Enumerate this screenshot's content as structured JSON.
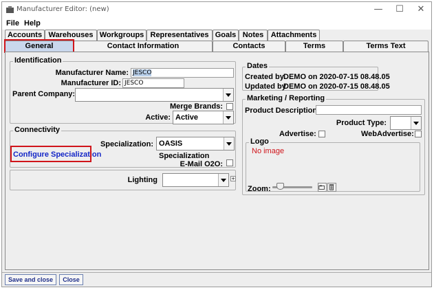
{
  "window": {
    "title": "Manufacturer Editor: (new)",
    "min": "—",
    "max": "☐",
    "close": "✕"
  },
  "menu": {
    "file": "File",
    "help": "Help"
  },
  "tabs_row1": [
    "Accounts",
    "Warehouses",
    "Workgroups",
    "Representatives",
    "Goals",
    "Notes",
    "Attachments"
  ],
  "tabs_row2": [
    "General",
    "Contact Information",
    "Contacts",
    "Terms",
    "Terms Text"
  ],
  "identification": {
    "title": "Identification",
    "name_label": "Manufacturer Name:",
    "name_value": "JESCO",
    "id_label": "Manufacturer ID:",
    "id_value": "JESCO",
    "parent_label": "Parent Company:",
    "parent_value": "",
    "merge_label": "Merge Brands:",
    "active_label": "Active:",
    "active_value": "Active"
  },
  "connectivity": {
    "title": "Connectivity",
    "spec_label": "Specialization:",
    "spec_value": "OASIS Specialization",
    "configure_link": "Configure Specialization",
    "email_label": "E-Mail O2O:"
  },
  "lighting": {
    "label": "Lighting",
    "value": ""
  },
  "dates": {
    "title": "Dates",
    "created_label": "Created by",
    "created_value": "DEMO on 2020-07-15 08.48.05",
    "updated_label": "Updated by",
    "updated_value": "DEMO on 2020-07-15 08.48.05"
  },
  "marketing": {
    "title": "Marketing / Reporting",
    "desc_label": "Product Description:",
    "desc_value": "",
    "type_label": "Product Type:",
    "type_value": "",
    "advertise_label": "Advertise:",
    "webadvertise_label": "WebAdvertise:"
  },
  "logo": {
    "title": "Logo",
    "no_image": "No image",
    "zoom_label": "Zoom:"
  },
  "footer": {
    "save_close": "Save and close",
    "close": "Close"
  },
  "colors": {
    "highlight": "#d0141a",
    "link": "#1427c7",
    "selected_tab": "#c9d7ec"
  }
}
